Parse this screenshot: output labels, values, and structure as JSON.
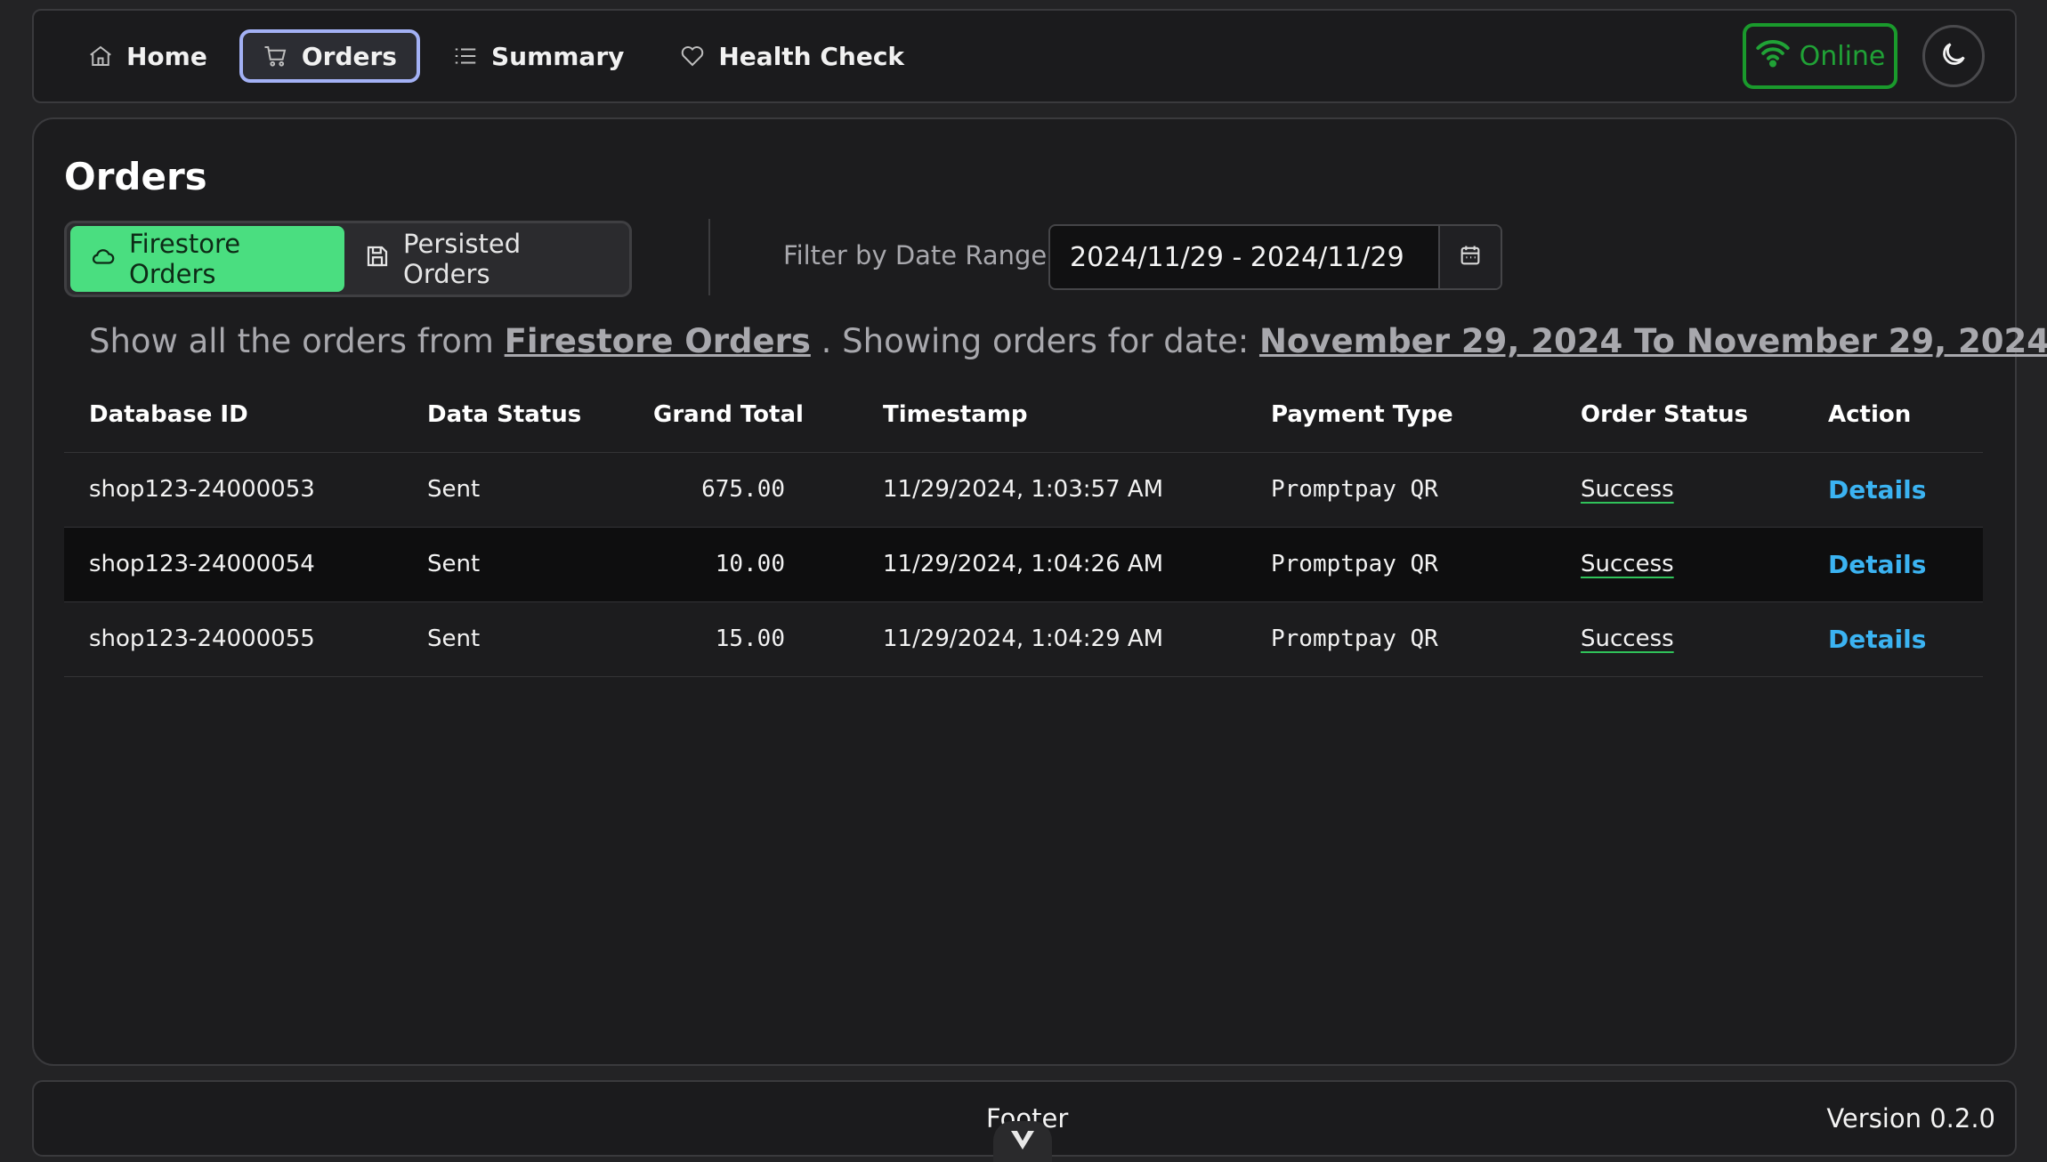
{
  "nav": {
    "items": [
      {
        "label": "Home",
        "icon": "home-icon"
      },
      {
        "label": "Orders",
        "icon": "cart-icon"
      },
      {
        "label": "Summary",
        "icon": "list-icon"
      },
      {
        "label": "Health Check",
        "icon": "heart-icon"
      }
    ],
    "online_label": "Online",
    "online_color": "#20a236",
    "theme_icon": "moon-icon"
  },
  "page": {
    "title": "Orders",
    "toggle": {
      "firestore_label": "Firestore Orders",
      "persisted_label": "Persisted Orders"
    },
    "filter_label": "Filter by Date Range:",
    "date_range_value": "2024/11/29 - 2024/11/29",
    "summary": {
      "prefix": "Show all the orders from",
      "source": "Firestore Orders",
      "middle": ". Showing orders for date:",
      "date_range_text": "November 29, 2024 To November 29, 2024"
    }
  },
  "table": {
    "headers": [
      "Database ID",
      "Data Status",
      "Grand Total",
      "Timestamp",
      "Payment Type",
      "Order Status",
      "Action"
    ],
    "rows": [
      {
        "id": "shop123-24000053",
        "data_status": "Sent",
        "grand_total": "675.00",
        "timestamp": "11/29/2024, 1:03:57 AM",
        "payment_type": "Promptpay QR",
        "order_status": "Success",
        "action": "Details"
      },
      {
        "id": "shop123-24000054",
        "data_status": "Sent",
        "grand_total": "10.00",
        "timestamp": "11/29/2024, 1:04:26 AM",
        "payment_type": "Promptpay QR",
        "order_status": "Success",
        "action": "Details"
      },
      {
        "id": "shop123-24000055",
        "data_status": "Sent",
        "grand_total": "15.00",
        "timestamp": "11/29/2024, 1:04:29 AM",
        "payment_type": "Promptpay QR",
        "order_status": "Success",
        "action": "Details"
      }
    ]
  },
  "footer": {
    "text": "Footer",
    "version": "Version 0.2.0"
  },
  "colors": {
    "accent_green": "#4ade80",
    "link_blue": "#3bb3f2",
    "active_border": "#a3b1f5"
  }
}
